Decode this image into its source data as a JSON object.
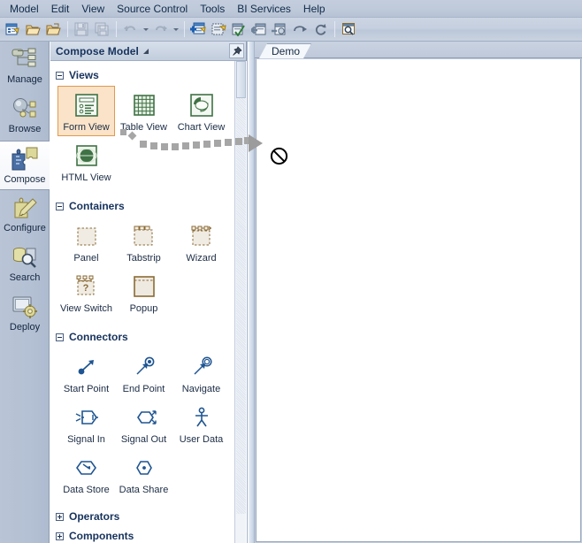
{
  "app": {
    "title": "Compose Model"
  },
  "menubar": {
    "items": [
      {
        "label": "Model"
      },
      {
        "label": "Edit"
      },
      {
        "label": "View"
      },
      {
        "label": "Source Control"
      },
      {
        "label": "Tools"
      },
      {
        "label": "BI Services"
      },
      {
        "label": "Help"
      }
    ]
  },
  "toolbar": {
    "buttons": [
      {
        "name": "new-model-icon",
        "label": "New Model"
      },
      {
        "name": "open-folder-icon",
        "label": "Open"
      },
      {
        "name": "open-recent-folder-icon",
        "label": "Open Recent"
      },
      {
        "name": "save-icon",
        "label": "Save",
        "disabled": true
      },
      {
        "name": "save-all-icon",
        "label": "Save All",
        "disabled": true
      },
      {
        "name": "undo-icon",
        "label": "Undo",
        "disabled": true
      },
      {
        "name": "redo-icon",
        "label": "Redo",
        "disabled": true
      },
      {
        "name": "add-object-icon",
        "label": "Add Object"
      },
      {
        "name": "new-view-icon",
        "label": "New View"
      },
      {
        "name": "validate-icon",
        "label": "Validate"
      },
      {
        "name": "import-icon",
        "label": "Import"
      },
      {
        "name": "export-icon",
        "label": "Export"
      },
      {
        "name": "promote-icon",
        "label": "Promote"
      },
      {
        "name": "refresh-icon",
        "label": "Refresh"
      },
      {
        "name": "preview-icon",
        "label": "Preview"
      }
    ]
  },
  "sidebar": {
    "items": [
      {
        "label": "Manage",
        "icon": "hierarchy-icon",
        "selected": false
      },
      {
        "label": "Browse",
        "icon": "network-icon",
        "selected": false
      },
      {
        "label": "Compose",
        "icon": "puzzle-add-icon",
        "selected": true
      },
      {
        "label": "Configure",
        "icon": "puzzle-pen-icon",
        "selected": false
      },
      {
        "label": "Search",
        "icon": "db-search-icon",
        "selected": false
      },
      {
        "label": "Deploy",
        "icon": "deploy-gear-icon",
        "selected": false
      }
    ]
  },
  "panel": {
    "title": "Compose Model",
    "pin_icon": "pin-icon",
    "title_menu_icon": "dropdown-arrow-icon",
    "groups": [
      {
        "label": "Views",
        "expanded": true,
        "items": [
          {
            "label": "Form View",
            "icon": "form-view-icon",
            "selected": true
          },
          {
            "label": "Table View",
            "icon": "table-view-icon",
            "selected": false
          },
          {
            "label": "Chart View",
            "icon": "chart-view-icon",
            "selected": false
          },
          {
            "label": "HTML View",
            "icon": "html-view-icon",
            "selected": false
          }
        ]
      },
      {
        "label": "Containers",
        "expanded": true,
        "items": [
          {
            "label": "Panel",
            "icon": "panel-icon",
            "selected": false
          },
          {
            "label": "Tabstrip",
            "icon": "tabstrip-icon",
            "selected": false
          },
          {
            "label": "Wizard",
            "icon": "wizard-icon",
            "selected": false
          },
          {
            "label": "View Switch",
            "icon": "view-switch-icon",
            "selected": false
          },
          {
            "label": "Popup",
            "icon": "popup-icon",
            "selected": false
          }
        ]
      },
      {
        "label": "Connectors",
        "expanded": true,
        "items": [
          {
            "label": "Start Point",
            "icon": "start-point-icon",
            "selected": false
          },
          {
            "label": "End Point",
            "icon": "end-point-icon",
            "selected": false
          },
          {
            "label": "Navigate",
            "icon": "navigate-icon",
            "selected": false
          },
          {
            "label": "Signal In",
            "icon": "signal-in-icon",
            "selected": false
          },
          {
            "label": "Signal Out",
            "icon": "signal-out-icon",
            "selected": false
          },
          {
            "label": "User Data",
            "icon": "user-data-icon",
            "selected": false
          },
          {
            "label": "Data Store",
            "icon": "data-store-icon",
            "selected": false
          },
          {
            "label": "Data Share",
            "icon": "data-share-icon",
            "selected": false
          }
        ]
      },
      {
        "label": "Operators",
        "expanded": false,
        "items": []
      },
      {
        "label": "Components",
        "expanded": false,
        "items": []
      }
    ]
  },
  "document": {
    "tabs": [
      {
        "label": "Demo",
        "active": true
      }
    ],
    "canvas": {
      "empty": true,
      "drag": {
        "active": true,
        "source_label": "Form View",
        "cursor_icon": "no-drop-icon",
        "trail_icon": "dashed-drag-trail"
      }
    }
  },
  "colors": {
    "chrome": "#c3cddd",
    "panel_bg": "#ffffff",
    "selection_fill": "#fae3c8",
    "selection_border": "#e09a4e",
    "view_icon": "#3f7245",
    "container_icon": "#8a6a35",
    "connector_icon": "#1f5592",
    "header_text": "#16325c"
  }
}
